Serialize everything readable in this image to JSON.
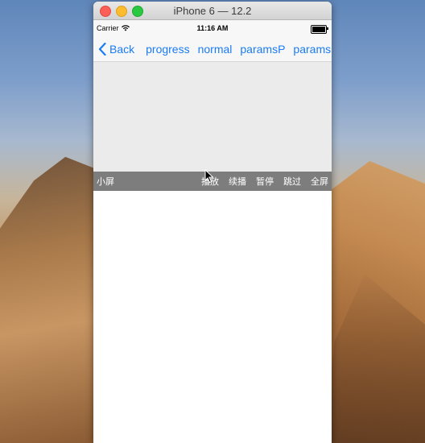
{
  "window": {
    "title": "iPhone 6 — 12.2"
  },
  "status_bar": {
    "carrier": "Carrier",
    "wifi_icon": "wifi-icon",
    "time": "11:16 AM",
    "battery_icon": "battery-icon",
    "battery_level": 1.0
  },
  "nav_bar": {
    "back_label": "Back",
    "items": [
      "progress",
      "normal",
      "paramsP",
      "params"
    ]
  },
  "player_controls": {
    "small_screen": "小屏",
    "play": "播放",
    "resume": "续播",
    "pause": "暂停",
    "skip": "跳过",
    "fullscreen": "全屏"
  },
  "colors": {
    "accent": "#1a7cf5",
    "control_bar": "#7d7d7d",
    "player_bg": "#ebebeb"
  }
}
